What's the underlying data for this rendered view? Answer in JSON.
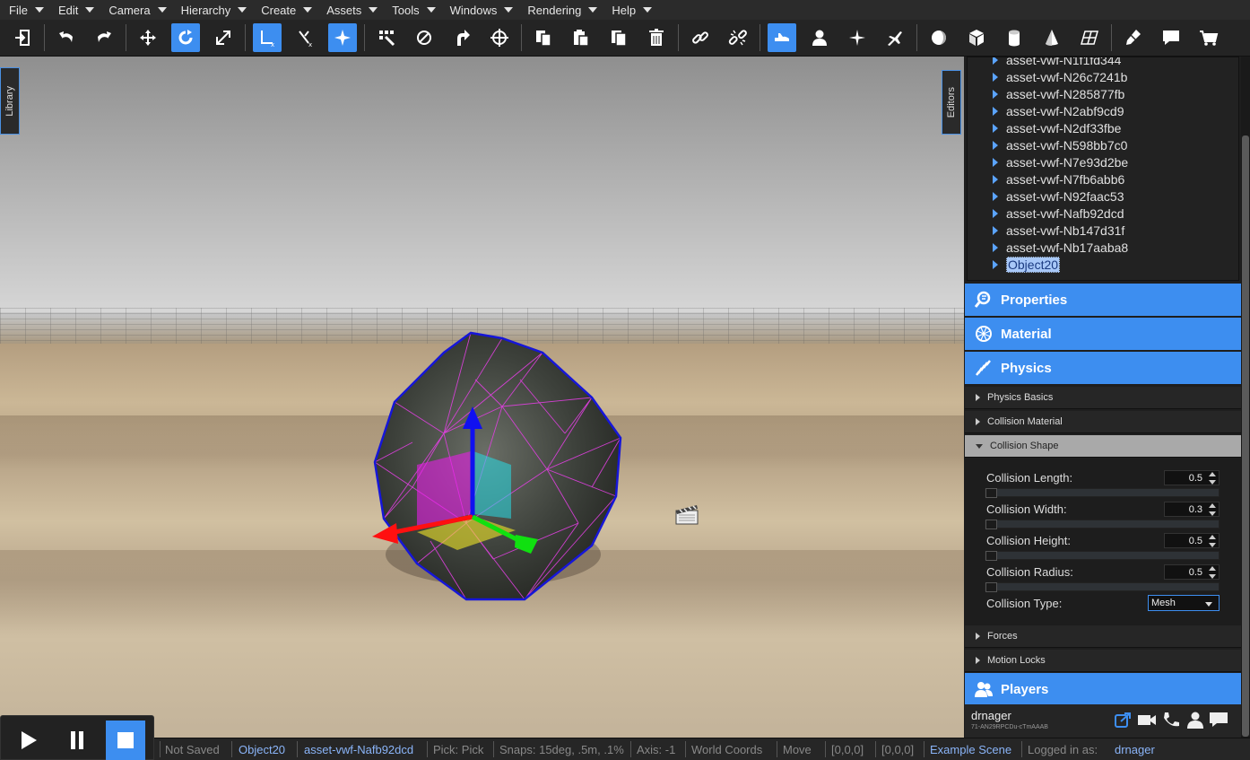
{
  "menu": [
    {
      "label": "File"
    },
    {
      "label": "Edit"
    },
    {
      "label": "Camera"
    },
    {
      "label": "Hierarchy"
    },
    {
      "label": "Create"
    },
    {
      "label": "Assets"
    },
    {
      "label": "Tools"
    },
    {
      "label": "Windows"
    },
    {
      "label": "Rendering"
    },
    {
      "label": "Help"
    }
  ],
  "side_tabs": {
    "library": "Library",
    "editors": "Editors"
  },
  "hierarchy": {
    "items": [
      "asset-vwf-N1f1fd344",
      "asset-vwf-N26c7241b",
      "asset-vwf-N285877fb",
      "asset-vwf-N2abf9cd9",
      "asset-vwf-N2df33fbe",
      "asset-vwf-N598bb7c0",
      "asset-vwf-N7e93d2be",
      "asset-vwf-N7fb6abb6",
      "asset-vwf-N92faac53",
      "asset-vwf-Nafb92dcd",
      "asset-vwf-Nb147d31f",
      "asset-vwf-Nb17aaba8",
      "Object20"
    ],
    "selected": "Object20"
  },
  "sections": {
    "properties": "Properties",
    "material": "Material",
    "physics": "Physics",
    "players": "Players"
  },
  "physics": {
    "subsections": {
      "basics": "Physics Basics",
      "material": "Collision Material",
      "shape": "Collision Shape",
      "forces": "Forces",
      "motion_locks": "Motion Locks"
    },
    "fields": {
      "length": {
        "label": "Collision Length:",
        "value": "0.5"
      },
      "width": {
        "label": "Collision Width:",
        "value": "0.3"
      },
      "height": {
        "label": "Collision Height:",
        "value": "0.5"
      },
      "radius": {
        "label": "Collision Radius:",
        "value": "0.5"
      },
      "type": {
        "label": "Collision Type:",
        "value": "Mesh"
      }
    }
  },
  "players": {
    "user": "drnager",
    "sub": "71-AN29RPCDu-cTmAAAB"
  },
  "status": {
    "saved": "Not Saved",
    "object": "Object20",
    "asset": "asset-vwf-Nafb92dcd",
    "pick": "Pick: Pick",
    "snaps": "Snaps: 15deg, .5m, .1%",
    "axis": "Axis: -1",
    "coords": "World Coords",
    "mode": "Move",
    "pos1": "[0,0,0]",
    "pos2": "[0,0,0]",
    "scene": "Example Scene",
    "logged_label": "Logged in as:",
    "logged_user": "drnager"
  },
  "colors": {
    "accent": "#3d8ef0",
    "link": "#8ab4f8"
  }
}
